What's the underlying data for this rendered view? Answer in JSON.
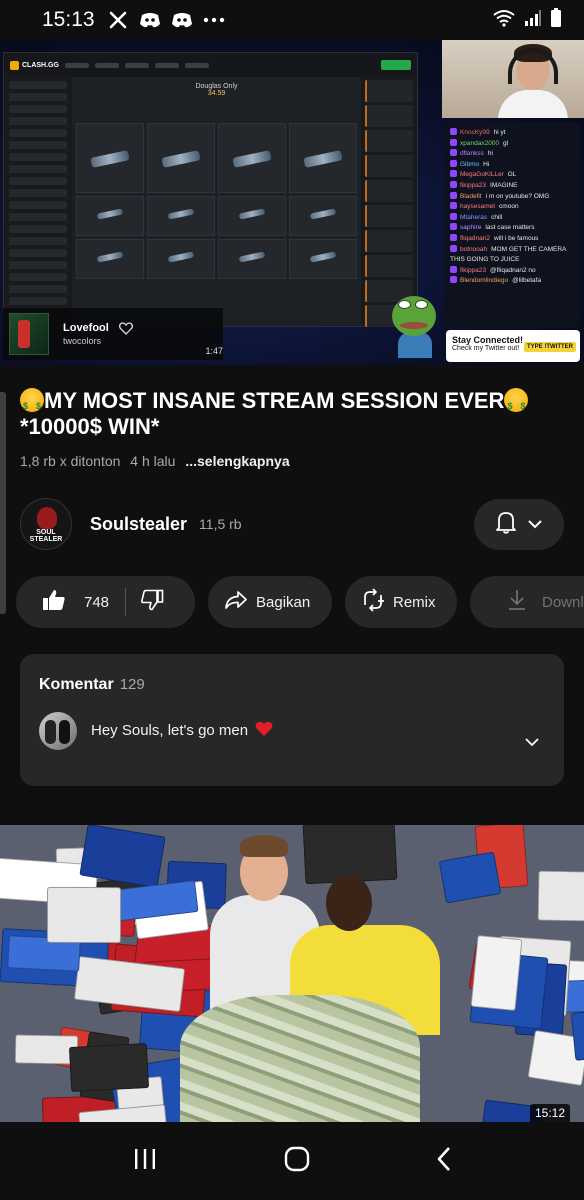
{
  "status_bar": {
    "time": "15:13",
    "icons_left": [
      "x-icon",
      "discord-icon",
      "discord-icon",
      "more-dots-icon"
    ],
    "icons_right": [
      "wifi-icon",
      "signal-icon",
      "battery-icon"
    ]
  },
  "player": {
    "site_logo": "CLASH.GG",
    "case_title": "Douglas Only",
    "case_price": "34.59",
    "chat_messages": [
      {
        "user": "KnocKy99",
        "text": "hi yt",
        "color": "#e86a6a"
      },
      {
        "user": "xpandax2000",
        "text": "gl",
        "color": "#7bd17b"
      },
      {
        "user": "dflankss",
        "text": "hi",
        "color": "#c77dff"
      },
      {
        "user": "Gibmo",
        "text": "Hi",
        "color": "#61c3ff"
      },
      {
        "user": "MegaGoKiLLer",
        "text": "GL",
        "color": "#ff7b7b"
      },
      {
        "user": "fikippa23",
        "text": "IMAGINE",
        "color": "#ff7b7b"
      },
      {
        "user": "Bladefit",
        "text": "i m on youtube? OMG",
        "color": "#f0a45a"
      },
      {
        "user": "haysesamet",
        "text": "cmoon",
        "color": "#ff7b7b"
      },
      {
        "user": "Mtaheras",
        "text": "chill",
        "color": "#7b9dff"
      },
      {
        "user": "saphire",
        "text": "last case matters",
        "color": "#b98cff"
      },
      {
        "user": "fliqadnan2",
        "text": "will i be famous",
        "color": "#ff7b7b"
      },
      {
        "user": "botnooah",
        "text": "MOM GET THE CAMERA THIS GOING TO JUICE",
        "color": "#ff7b7b"
      },
      {
        "user": "fikippa23",
        "text": "@fliqadnan2 no",
        "color": "#ff7b7b"
      },
      {
        "user": "Blendomlindiego",
        "text": "@lilbetafa",
        "color": "#f0a45a"
      }
    ],
    "twitter_box": {
      "title": "Stay Connected!",
      "subtitle": "Check my Twitter out!",
      "tag": "TYPE !TWITTER"
    },
    "now_playing": {
      "song": "Lovefool",
      "artist": "twocolors",
      "duration": "1:47"
    }
  },
  "video": {
    "title": "MY MOST INSANE STREAM SESSION EVER *10000$ WIN*",
    "title_line1": "MY MOST INSANE STREAM SESSION EVER",
    "title_line2": "*10000$ WIN*",
    "views": "1,8 rb x ditonton",
    "age": "4 h lalu",
    "more": "...selengkapnya"
  },
  "channel": {
    "name": "Soulstealer",
    "subscribers": "11,5 rb",
    "avatar_text_top": "SOUL",
    "avatar_text_bottom": "STEALER"
  },
  "actions": {
    "like_count": "748",
    "share_label": "Bagikan",
    "remix_label": "Remix",
    "download_label": "Download"
  },
  "comments": {
    "header": "Komentar",
    "count": "129",
    "top_comment": "Hey Souls, let's go men"
  },
  "next_video": {
    "duration": "15:12"
  },
  "colors": {
    "background": "#0f0f0f",
    "pill": "#272727",
    "heart": "#e0202a",
    "secondary_text": "#aaaaaa"
  }
}
